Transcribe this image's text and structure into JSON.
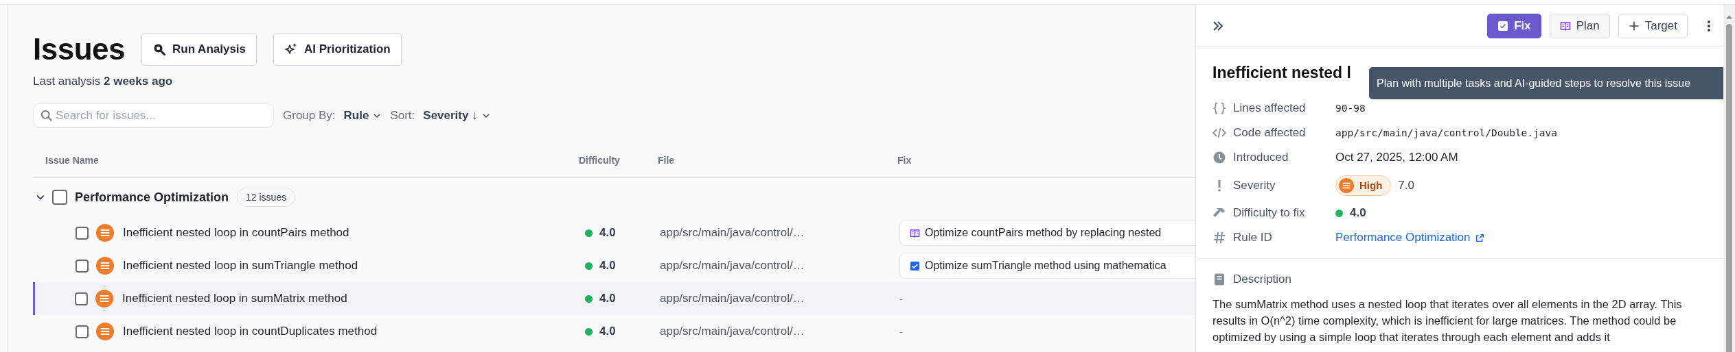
{
  "page": {
    "title": "Issues",
    "actions": [
      {
        "label": "Run Analysis",
        "kind": "analyze"
      },
      {
        "label": "AI Prioritization",
        "kind": "ai"
      }
    ],
    "last_analysis": "Last analysis **2 weeks ago**",
    "search": {
      "placeholder": "Search for issues..."
    },
    "group_by": {
      "label": "Group By:",
      "value": "Rule"
    },
    "sort": {
      "label": "Sort:",
      "value": "Severity ↓"
    }
  },
  "table": {
    "columns": [
      "Issue Name",
      "Difficulty",
      "File",
      "Fix"
    ],
    "groups": [
      {
        "name": "Performance Optimization",
        "count": "12 issues",
        "expanded": true,
        "checked": false,
        "rows": [
          {
            "name": "Inefficient nested loop in countPairs method",
            "difficulty": "4.0",
            "file": "app/src/main/java/control/…",
            "fix": {
              "kind": "plan",
              "text": "Optimize countPairs method by replacing nested"
            },
            "selected": false,
            "checked": false
          },
          {
            "name": "Inefficient nested loop in sumTriangle method",
            "difficulty": "4.0",
            "file": "app/src/main/java/control/…",
            "fix": {
              "kind": "fix",
              "text": "Optimize sumTriangle method using mathematica"
            },
            "selected": false,
            "checked": false
          },
          {
            "name": "Inefficient nested loop in sumMatrix method",
            "difficulty": "4.0",
            "file": "app/src/main/java/control/…",
            "fix": {
              "kind": "none",
              "text": "-"
            },
            "selected": true,
            "checked": false
          },
          {
            "name": "Inefficient nested loop in countDuplicates method",
            "difficulty": "4.0",
            "file": "app/src/main/java/control/…",
            "fix": {
              "kind": "none",
              "text": "-"
            },
            "selected": false,
            "checked": false
          }
        ]
      }
    ]
  },
  "panel": {
    "actions": [
      {
        "label": "Fix",
        "kind": "fix"
      },
      {
        "label": "Plan",
        "kind": "plan"
      },
      {
        "label": "Target",
        "kind": "target"
      }
    ],
    "title": "Inefficient nested l",
    "tooltip": "Plan with multiple tasks and AI-guided steps to resolve this issue",
    "details": [
      {
        "kind": "lines",
        "label": "Lines affected",
        "value": "90-98"
      },
      {
        "kind": "file",
        "label": "Code affected",
        "value": "app/src/main/java/control/Double.java"
      },
      {
        "kind": "date",
        "label": "Introduced",
        "value": "Oct 27, 2025, 12:00 AM"
      },
      {
        "kind": "severity",
        "label": "Severity",
        "badge": "High",
        "value": "7.0"
      },
      {
        "kind": "difficulty",
        "label": "Difficulty to fix",
        "value": "4.0"
      },
      {
        "kind": "rule",
        "label": "Rule ID",
        "value": "Performance Optimization"
      }
    ],
    "description": {
      "heading": "Description",
      "text": "The sumMatrix method uses a nested loop that iterates over all elements in the 2D array. This results in O(n^2) time complexity, which is inefficient for large matrices. The method could be optimized by using a simple loop that iterates through each element and adds it"
    }
  }
}
